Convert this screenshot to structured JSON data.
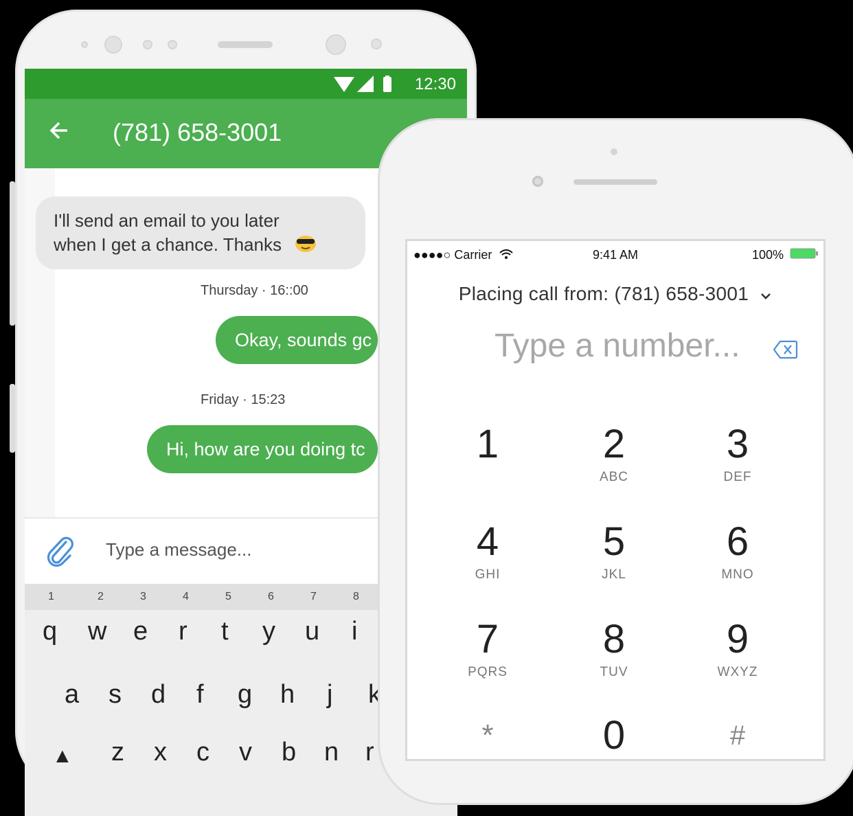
{
  "android": {
    "status": {
      "time": "12:30"
    },
    "appbar": {
      "title": "(781) 658-3001",
      "back_icon": "arrow-left-icon"
    },
    "messages": [
      {
        "direction": "in",
        "lines": [
          "I'll send an email to you later",
          "when I get a chance. Thanks"
        ],
        "emoji": "😎"
      },
      {
        "timestamp": "Thursday · 16::00"
      },
      {
        "direction": "out",
        "text": "Okay, sounds gc"
      },
      {
        "timestamp": "Friday · 15:23"
      },
      {
        "direction": "out",
        "text": "Hi, how are you doing tc"
      }
    ],
    "composer": {
      "placeholder": "Type a message...",
      "attach_icon": "paperclip-icon"
    },
    "keyboard": {
      "numbers": [
        "1",
        "2",
        "3",
        "4",
        "5",
        "6",
        "7",
        "8"
      ],
      "row1": [
        "q",
        "w",
        "e",
        "r",
        "t",
        "y",
        "u",
        "i"
      ],
      "row2": [
        "a",
        "s",
        "d",
        "f",
        "g",
        "h",
        "j",
        "k"
      ],
      "row3": [
        "z",
        "x",
        "c",
        "v",
        "b",
        "n",
        "r"
      ]
    }
  },
  "iphone": {
    "status": {
      "carrier": "●●●●○ Carrier",
      "time": "9:41 AM",
      "battery": "100%"
    },
    "placing_call": "Placing call from: (781) 658-3001",
    "number_placeholder": "Type a number...",
    "keys": [
      {
        "digit": "1",
        "letters": ""
      },
      {
        "digit": "2",
        "letters": "ABC"
      },
      {
        "digit": "3",
        "letters": "DEF"
      },
      {
        "digit": "4",
        "letters": "GHI"
      },
      {
        "digit": "5",
        "letters": "JKL"
      },
      {
        "digit": "6",
        "letters": "MNO"
      },
      {
        "digit": "7",
        "letters": "PQRS"
      },
      {
        "digit": "8",
        "letters": "TUV"
      },
      {
        "digit": "9",
        "letters": "WXYZ"
      },
      {
        "digit": "*",
        "letters": ""
      },
      {
        "digit": "0",
        "letters": ""
      },
      {
        "digit": "#",
        "letters": ""
      }
    ],
    "colors": {
      "green": "#4caf50",
      "dark_green": "#2e9b2e",
      "backspace": "#4a90d9"
    }
  }
}
